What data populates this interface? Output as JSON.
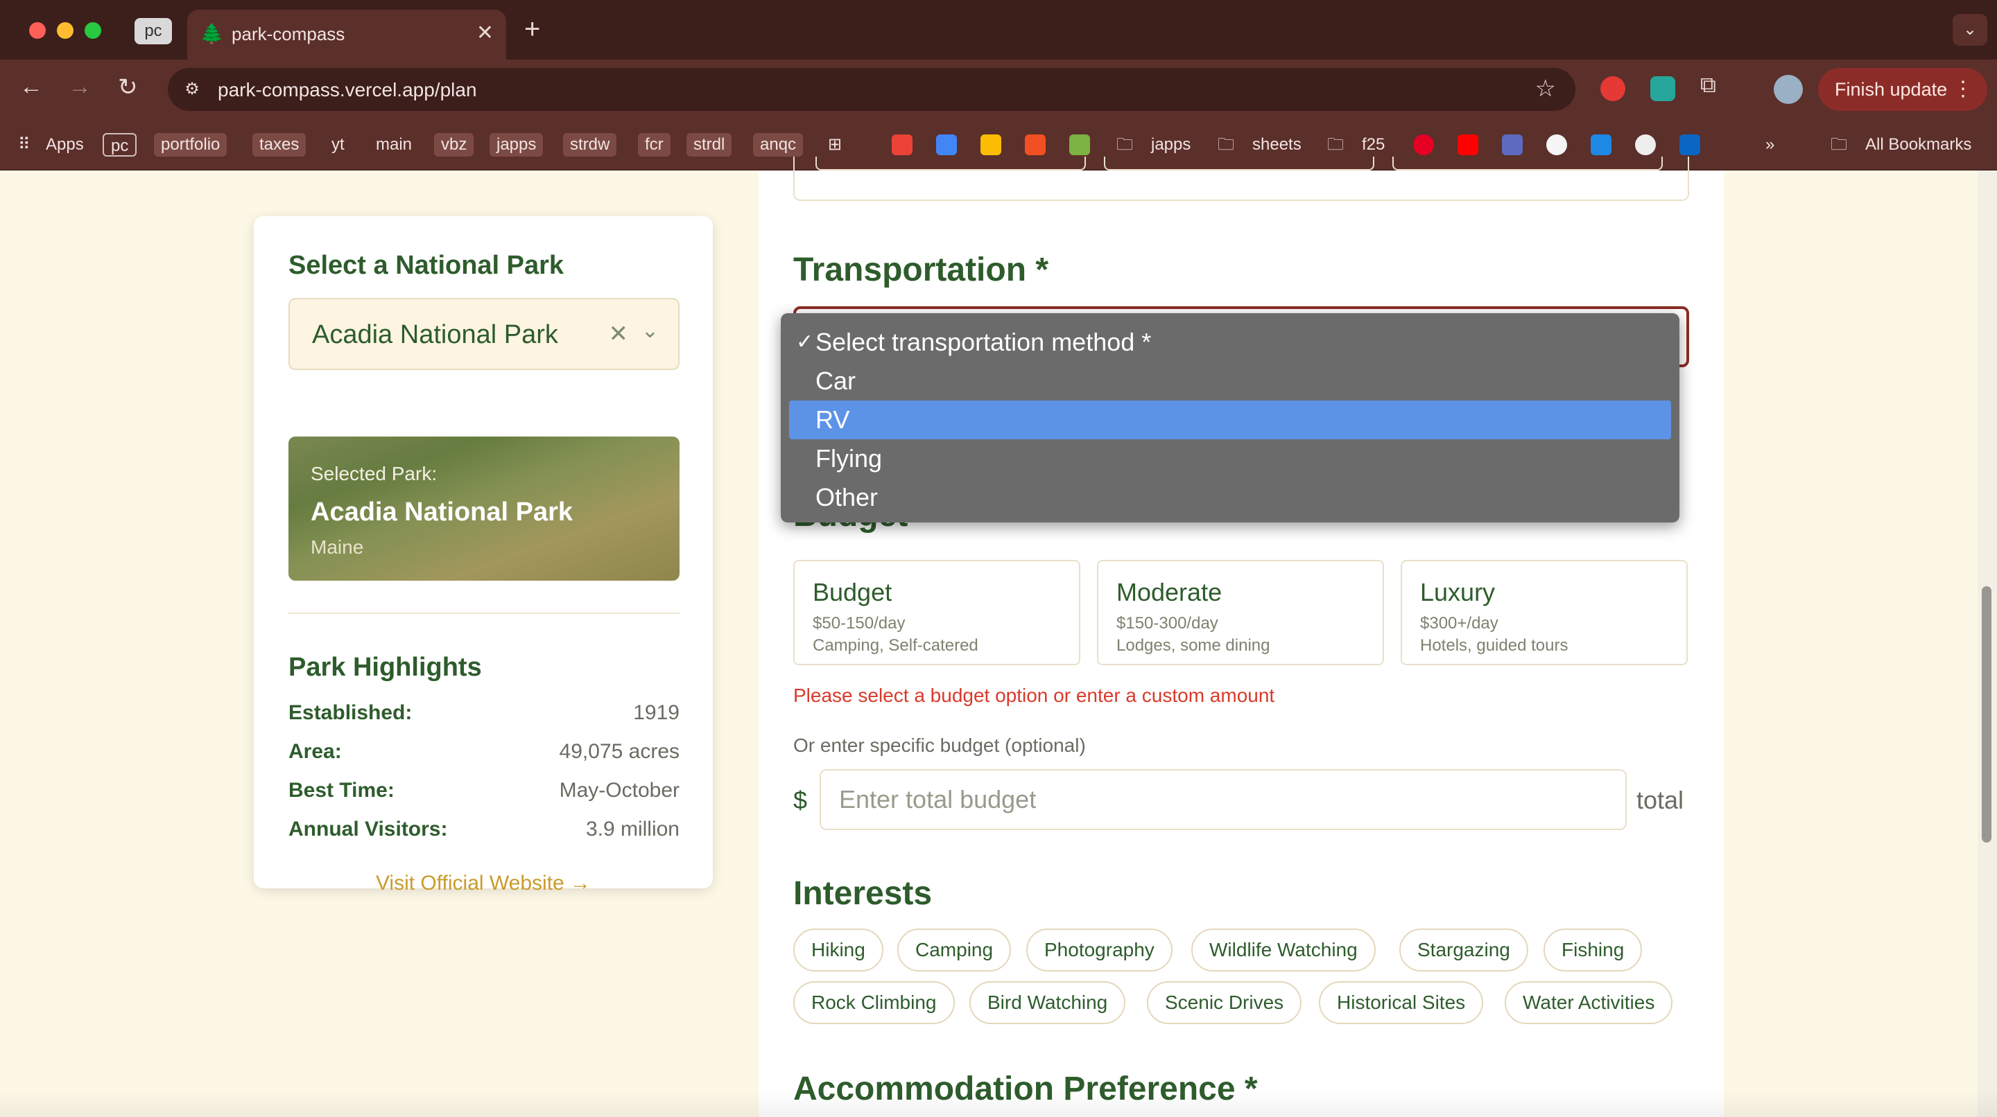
{
  "browser": {
    "pinned_tab": "pc",
    "tab_title": "park-compass",
    "url": "park-compass.vercel.app/plan",
    "finish_update_label": "Finish update",
    "bookmarks": [
      "Apps",
      "pc",
      "portfolio",
      "taxes",
      "yt",
      "main",
      "vbz",
      "japps",
      "strdw",
      "fcr",
      "strdl",
      "anqc",
      "japps",
      "sheets",
      "f25",
      "All Bookmarks"
    ]
  },
  "sidebar": {
    "heading": "Select a National Park",
    "selected_park": "Acadia National Park",
    "banner": {
      "label": "Selected Park:",
      "name": "Acadia National Park",
      "state": "Maine"
    },
    "highlights_heading": "Park Highlights",
    "highlights": [
      {
        "key": "Established:",
        "value": "1919"
      },
      {
        "key": "Area:",
        "value": "49,075 acres"
      },
      {
        "key": "Best Time:",
        "value": "May-October"
      },
      {
        "key": "Annual Visitors:",
        "value": "3.9 million"
      }
    ],
    "visit_link": "Visit Official Website →"
  },
  "form": {
    "transportation_title": "Transportation *",
    "transport_options": [
      {
        "label": "Select transportation method *",
        "checked": true
      },
      {
        "label": "Car"
      },
      {
        "label": "RV",
        "highlighted": true
      },
      {
        "label": "Flying"
      },
      {
        "label": "Other"
      }
    ],
    "budget_title": "Budget",
    "budget_options": [
      {
        "name": "Budget",
        "price": "$50-150/day",
        "desc": "Camping, Self-catered"
      },
      {
        "name": "Moderate",
        "price": "$150-300/day",
        "desc": "Lodges, some dining"
      },
      {
        "name": "Luxury",
        "price": "$300+/day",
        "desc": "Hotels, guided tours"
      }
    ],
    "budget_error": "Please select a budget option or enter a custom amount",
    "specific_budget_label": "Or enter specific budget (optional)",
    "currency_symbol": "$",
    "budget_placeholder": "Enter total budget",
    "total_suffix": "total",
    "interests_title": "Interests",
    "interests": [
      "Hiking",
      "Camping",
      "Photography",
      "Wildlife Watching",
      "Stargazing",
      "Fishing",
      "Rock Climbing",
      "Bird Watching",
      "Scenic Drives",
      "Historical Sites",
      "Water Activities"
    ],
    "accommodation_title": "Accommodation Preference *"
  },
  "colors": {
    "forest_green": "#2e5c2c",
    "accent_gold": "#c99b2a",
    "error_red": "#d93a2b",
    "dropdown_highlight": "#5d93e6"
  }
}
